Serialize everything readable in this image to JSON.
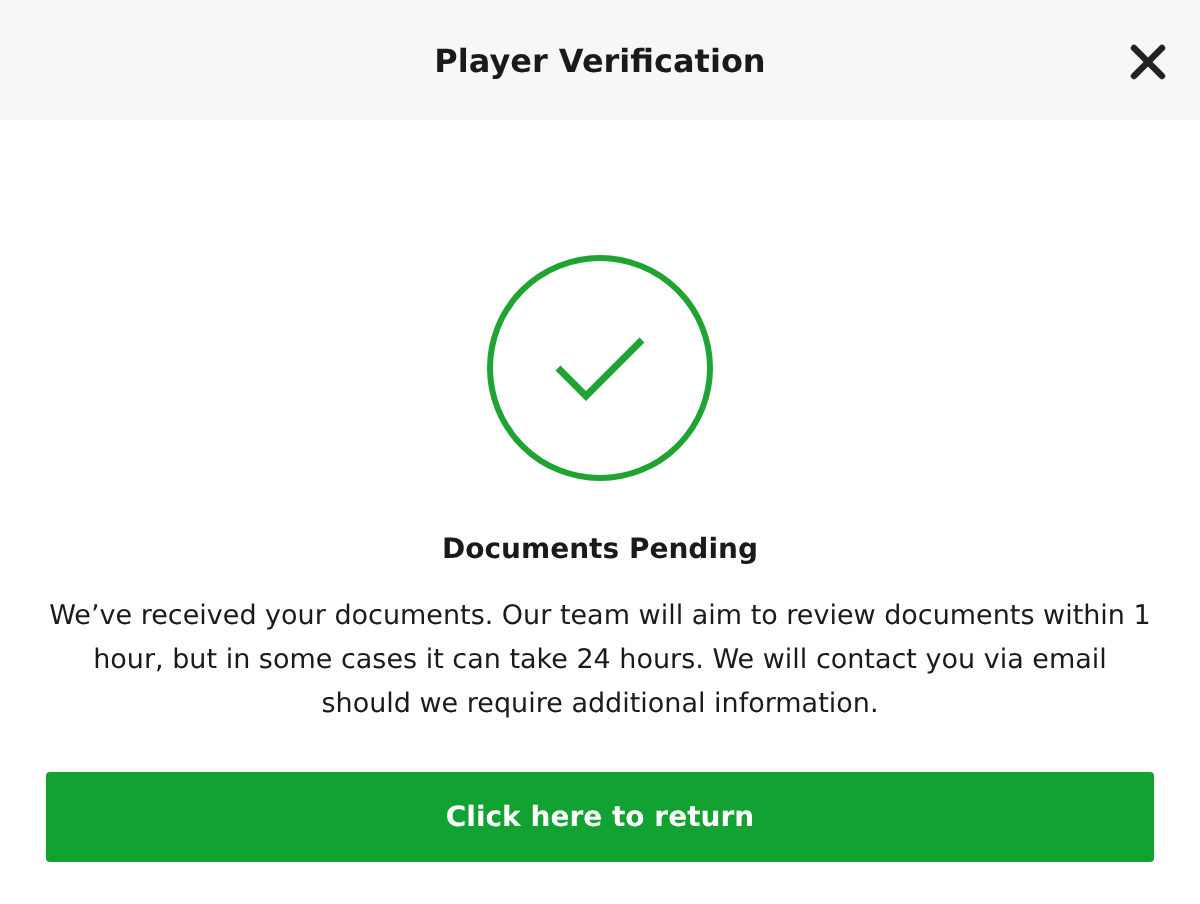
{
  "header": {
    "title": "Player Verification"
  },
  "status": {
    "title": "Documents Pending",
    "message": "We’ve received your documents. Our team will aim to review documents within 1 hour, but in some cases it can take 24 hours. We will contact you via email should we require additional information."
  },
  "button": {
    "label": "Click here to return"
  }
}
